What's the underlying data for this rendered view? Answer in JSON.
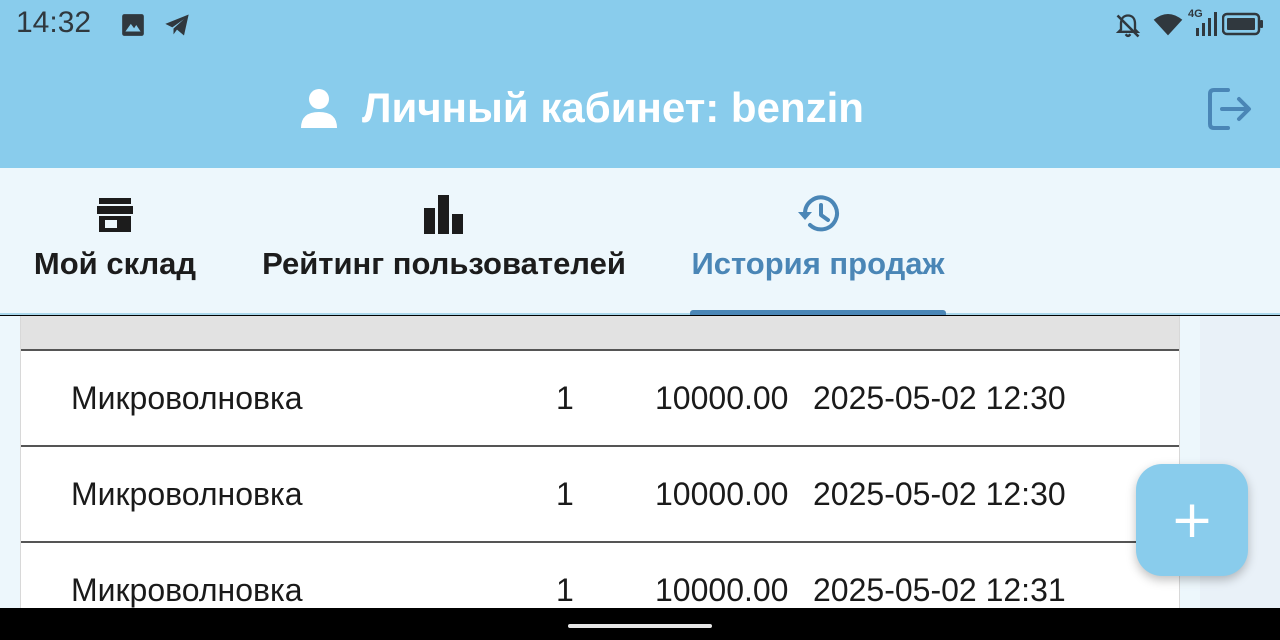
{
  "status_bar": {
    "time": "14:32",
    "left_icons": [
      "image-icon",
      "telegram-icon"
    ],
    "right_icons": [
      "bell-off-icon",
      "wifi-icon",
      "cellular-4g-icon",
      "battery-icon"
    ],
    "network_label": "4G"
  },
  "app_bar": {
    "title": "Личный кабинет: benzin",
    "user_icon": "person-icon",
    "logout_icon": "logout-icon"
  },
  "tabs": [
    {
      "label": "Мой склад",
      "icon": "store-icon",
      "active": false
    },
    {
      "label": "Рейтинг пользователей",
      "icon": "bar-chart-icon",
      "active": false
    },
    {
      "label": "История продаж",
      "icon": "history-icon",
      "active": true
    }
  ],
  "sales": {
    "rows": [
      {
        "name": "Микроволновка",
        "qty": "1",
        "price": "10000.00",
        "date": "2025-05-02 12:30"
      },
      {
        "name": "Микроволновка",
        "qty": "1",
        "price": "10000.00",
        "date": "2025-05-02 12:30"
      },
      {
        "name": "Микроволновка",
        "qty": "1",
        "price": "10000.00",
        "date": "2025-05-02 12:31"
      }
    ]
  },
  "fab": {
    "label": "+",
    "icon": "plus-icon"
  },
  "colors": {
    "primary": "#89CCEC",
    "accent": "#4A86B6",
    "tab_bar_bg": "#EDF7FC",
    "header_row_bg": "#E2E2E2"
  }
}
